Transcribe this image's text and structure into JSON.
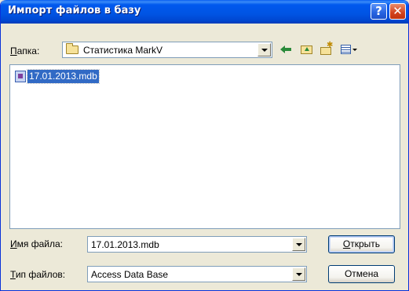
{
  "window": {
    "title": "Импорт файлов в базу",
    "help_glyph": "?",
    "close_glyph": "✕"
  },
  "lookin": {
    "label": "Папка:",
    "accesskey": "П",
    "label_rest": "апка:",
    "folder": "Статистика MarkV",
    "folder_icon": "folder-icon"
  },
  "toolbar": {
    "icons": [
      "back-arrow-icon",
      "up-folder-icon",
      "new-folder-icon",
      "views-menu-icon"
    ]
  },
  "files": [
    {
      "name": "17.01.2013.mdb",
      "icon": "access-database-icon",
      "selected": true
    }
  ],
  "filename": {
    "accesskey": "И",
    "label_rest": "мя файла:",
    "value": "17.01.2013.mdb"
  },
  "filetype": {
    "accesskey": "Т",
    "label_rest": "ип файлов:",
    "value": "Access Data Base"
  },
  "buttons": {
    "open_accesskey": "О",
    "open_rest": "ткрыть",
    "cancel": "Отмена"
  },
  "colors": {
    "titlebar": "#0054E3",
    "selection": "#316AC5",
    "face": "#ECE9D8"
  }
}
